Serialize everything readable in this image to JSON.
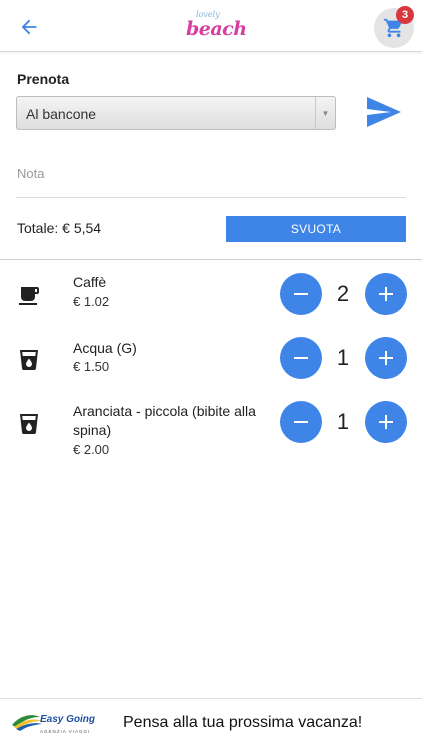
{
  "header": {
    "logo_small": "lovely",
    "logo_big": "beach",
    "cart_count": "3"
  },
  "order": {
    "label": "Prenota",
    "selected_option": "Al bancone",
    "note_placeholder": "Nota",
    "total_label": "Totale: € 5,54",
    "clear_button": "SVUOTA"
  },
  "items": [
    {
      "icon": "coffee-cup-icon",
      "name": "Caffè",
      "price": "€ 1.02",
      "qty": "2"
    },
    {
      "icon": "water-glass-icon",
      "name": "Acqua (G)",
      "price": "€ 1.50",
      "qty": "1"
    },
    {
      "icon": "drink-glass-icon",
      "name": "Aranciata - piccola (bibite alla spina)",
      "price": "€ 2.00",
      "qty": "1"
    }
  ],
  "ad": {
    "brand": "Easy Going",
    "brand_sub": "AGENZIA VIAGGI",
    "text": "Pensa alla tua prossima vacanza!"
  },
  "colors": {
    "accent": "#3f85e8",
    "badge": "#d9363e",
    "logo": "#d63fa0"
  }
}
